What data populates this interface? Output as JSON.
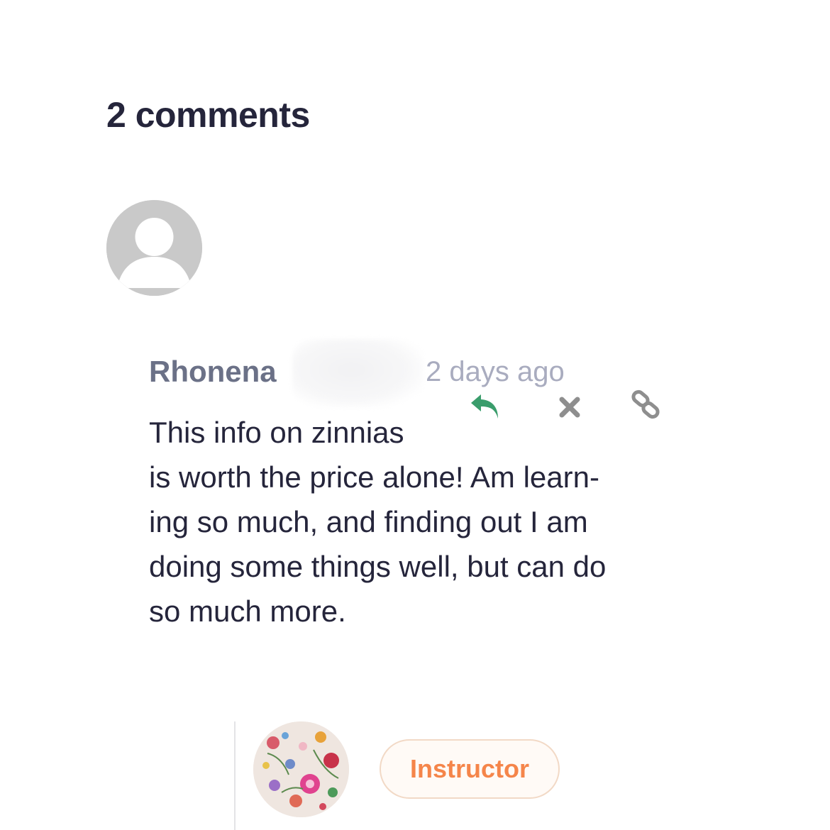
{
  "comments_section": {
    "title": "2 comments"
  },
  "comment": {
    "author": "Rhonena",
    "time": "2 days ago",
    "body_lines": [
      "This info on zinnias",
      "is worth the price alone! Am learn-",
      "ing so much, and finding out I am",
      "doing some things well, but can do",
      "so much more."
    ],
    "actions": {
      "reply_icon": "reply-arrow-icon",
      "delete_icon": "close-x-icon",
      "link_icon": "chain-link-icon"
    }
  },
  "reply": {
    "badge": "Instructor"
  },
  "colors": {
    "title": "#25253b",
    "author": "#6b7187",
    "date": "#a9acbf",
    "reply_icon": "#3a9d6c",
    "action_gray": "#8e8e8e",
    "badge_text": "#f5854a",
    "badge_border": "#f2d9c6"
  }
}
